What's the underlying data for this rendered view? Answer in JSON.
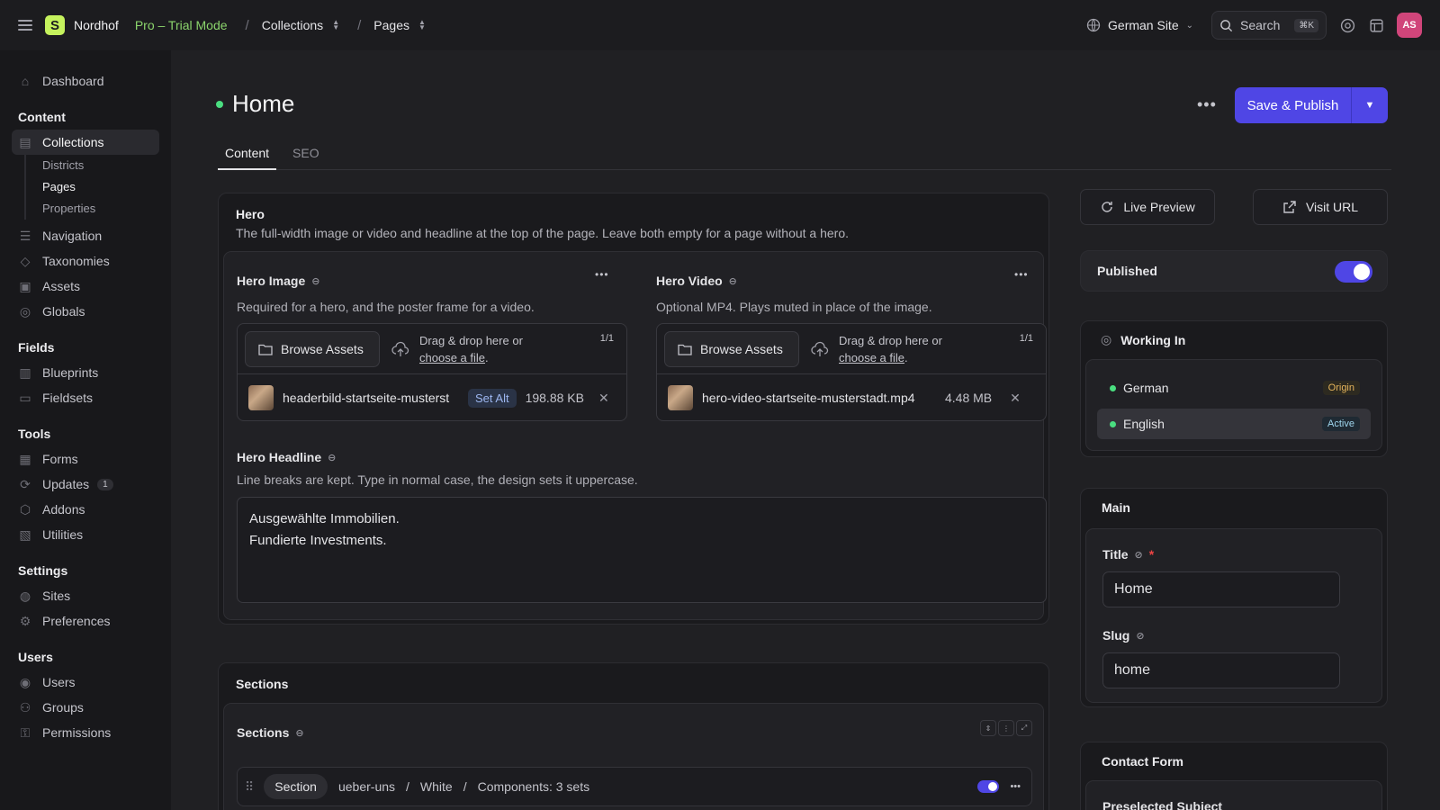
{
  "topbar": {
    "brand": "Nordhof",
    "trial": "Pro – Trial Mode",
    "crumbs": [
      "Collections",
      "Pages"
    ],
    "site": "German Site",
    "search_label": "Search",
    "search_kbd": "⌘K",
    "avatar": "AS"
  },
  "sidebar": {
    "dashboard": "Dashboard",
    "content_head": "Content",
    "collections": "Collections",
    "sub": [
      "Districts",
      "Pages",
      "Properties"
    ],
    "navigation": "Navigation",
    "taxonomies": "Taxonomies",
    "assets": "Assets",
    "globals": "Globals",
    "fields_head": "Fields",
    "blueprints": "Blueprints",
    "fieldsets": "Fieldsets",
    "tools_head": "Tools",
    "forms": "Forms",
    "updates": "Updates",
    "updates_count": "1",
    "addons": "Addons",
    "utilities": "Utilities",
    "settings_head": "Settings",
    "sites": "Sites",
    "preferences": "Preferences",
    "users_head": "Users",
    "users": "Users",
    "groups": "Groups",
    "permissions": "Permissions"
  },
  "page": {
    "title": "Home",
    "save_publish": "Save & Publish",
    "tabs": [
      "Content",
      "SEO"
    ]
  },
  "hero": {
    "title": "Hero",
    "desc": "The full-width image or video and headline at the top of the page. Leave both empty for a page without a hero.",
    "image_label": "Hero Image",
    "image_desc": "Required for a hero, and the poster frame for a video.",
    "video_label": "Hero Video",
    "video_desc": "Optional MP4. Plays muted in place of the image.",
    "browse": "Browse Assets",
    "drop_line1": "Drag & drop here or",
    "drop_line2": "choose a file",
    "drop_suffix": ".",
    "count": "1/1",
    "image_file": "headerbild-startseite-musterst",
    "set_alt": "Set Alt",
    "image_size": "198.88 KB",
    "video_file": "hero-video-startseite-musterstadt.mp4",
    "video_size": "4.48 MB",
    "headline_label": "Hero Headline",
    "headline_desc": "Line breaks are kept. Type in normal case, the design sets it uppercase.",
    "headline_line1": "Ausgewählte Immobilien.",
    "headline_line2": "Fundierte Investments."
  },
  "sections": {
    "outer_title": "Sections",
    "inner_title": "Sections",
    "row_pill": "Section",
    "row_slug": "ueber-uns",
    "row_sep": "/",
    "row_color": "White",
    "row_components": "Components: 3 sets"
  },
  "aside": {
    "live_preview": "Live Preview",
    "visit_url": "Visit URL",
    "published": "Published",
    "working_in": "Working In",
    "german": "German",
    "origin": "Origin",
    "english": "English",
    "active": "Active",
    "main_title": "Main",
    "title_label": "Title",
    "required": "*",
    "title_value": "Home",
    "slug_label": "Slug",
    "slug_value": "home",
    "contact_title": "Contact Form",
    "preselected": "Preselected Subject"
  },
  "colors": {
    "accent": "#4f46e5",
    "status_green": "#4ade80",
    "logo": "#c5f25d",
    "trial": "#8bd46c"
  }
}
